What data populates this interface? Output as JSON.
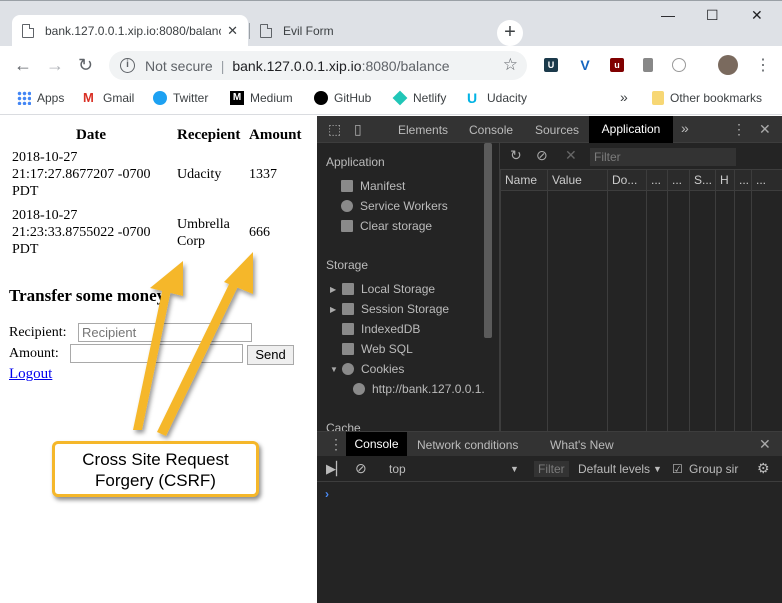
{
  "tabs": [
    {
      "title": "bank.127.0.0.1.xip.io:8080/balanc",
      "close": "✕"
    },
    {
      "title": "Evil Form"
    }
  ],
  "window": {
    "minimize": "—",
    "maximize": "☐",
    "close": "✕",
    "new_tab": "+"
  },
  "toolbar": {
    "not_secure": "Not secure",
    "url_host": "bank.127.0.0.1.xip.io",
    "url_rest": ":8080/balance"
  },
  "bookmarks": {
    "items": [
      "Apps",
      "Gmail",
      "Twitter",
      "Medium",
      "GitHub",
      "Netlify",
      "Udacity"
    ],
    "overflow": "»",
    "other": "Other bookmarks"
  },
  "page": {
    "table": {
      "headers": [
        "Date",
        "Recepient",
        "Amount"
      ],
      "rows": [
        {
          "date_line1": "2018-10-27",
          "date_line2": "21:17:27.8677207 -0700",
          "date_line3": "PDT",
          "recipient_line1": "Udacity",
          "recipient_line2": "",
          "amount": "1337"
        },
        {
          "date_line1": "2018-10-27",
          "date_line2": "21:23:33.8755022 -0700",
          "date_line3": "PDT",
          "recipient_line1": "Umbrella",
          "recipient_line2": "Corp",
          "amount": "666"
        }
      ]
    },
    "transfer_heading": "Transfer some money",
    "recipient_label": "Recipient:",
    "recipient_placeholder": "Recipient",
    "amount_label": "Amount:",
    "send_label": "Send",
    "logout_label": "Logout"
  },
  "devtools": {
    "tabs": [
      "Elements",
      "Console",
      "Sources",
      "Application"
    ],
    "more": "»",
    "sidebar": {
      "application_header": "Application",
      "application_items": [
        "Manifest",
        "Service Workers",
        "Clear storage"
      ],
      "storage_header": "Storage",
      "storage_items": [
        "Local Storage",
        "Session Storage",
        "IndexedDB",
        "Web SQL",
        "Cookies"
      ],
      "cookie_child": "http://bank.127.0.0.1.",
      "cache_header": "Cache"
    },
    "filter_placeholder": "Filter",
    "columns": [
      "Name",
      "Value",
      "Do...",
      "...",
      "...",
      "S...",
      "H",
      "..."
    ],
    "drawer_tabs": [
      "Console",
      "Network conditions",
      "What's New"
    ],
    "console_toolbar": {
      "context": "top",
      "filter": "Filter",
      "levels": "Default levels",
      "group": "Group sir"
    },
    "prompt": "›"
  },
  "annotation": {
    "line1": "Cross Site Request",
    "line2": "Forgery (CSRF)",
    "color": "#f5b72a"
  }
}
